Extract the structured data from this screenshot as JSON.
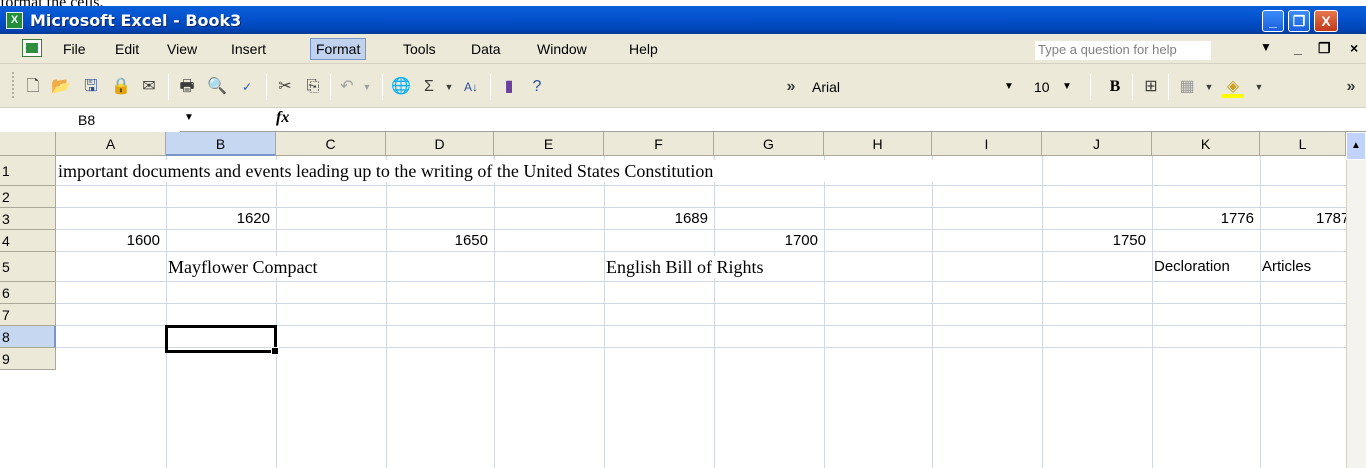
{
  "doc_text": "format the cells.",
  "window": {
    "title": "Microsoft Excel - Book3",
    "minimize": "_",
    "restore": "❐",
    "close": "X"
  },
  "menu": {
    "items": [
      "File",
      "Edit",
      "View",
      "Insert",
      "Format",
      "Tools",
      "Data",
      "Window",
      "Help"
    ],
    "active": "Format",
    "help_placeholder": "Type a question for help"
  },
  "toolbar": {
    "font_name": "Arial",
    "font_size": "10",
    "bold": "B",
    "more": "»"
  },
  "formula_bar": {
    "name_box": "B8",
    "fx_label": "fx",
    "content": ""
  },
  "sheet": {
    "columns": [
      "A",
      "B",
      "C",
      "D",
      "E",
      "F",
      "G",
      "H",
      "I",
      "J",
      "K",
      "L"
    ],
    "rows": [
      "1",
      "2",
      "3",
      "4",
      "5",
      "6",
      "7",
      "8",
      "9"
    ],
    "selected_cell": "B8",
    "cells": {
      "A1": "important documents and events leading up to the writing of the United States Constitution",
      "B3": "1620",
      "F3": "1689",
      "K3": "1776",
      "L3": "1787",
      "A4": "1600",
      "D4": "1650",
      "G4": "1700",
      "J4": "1750",
      "B5": "Mayflower Compact",
      "F5": "English Bill of Rights",
      "K5": "Decloration",
      "L5": "Articles"
    }
  }
}
